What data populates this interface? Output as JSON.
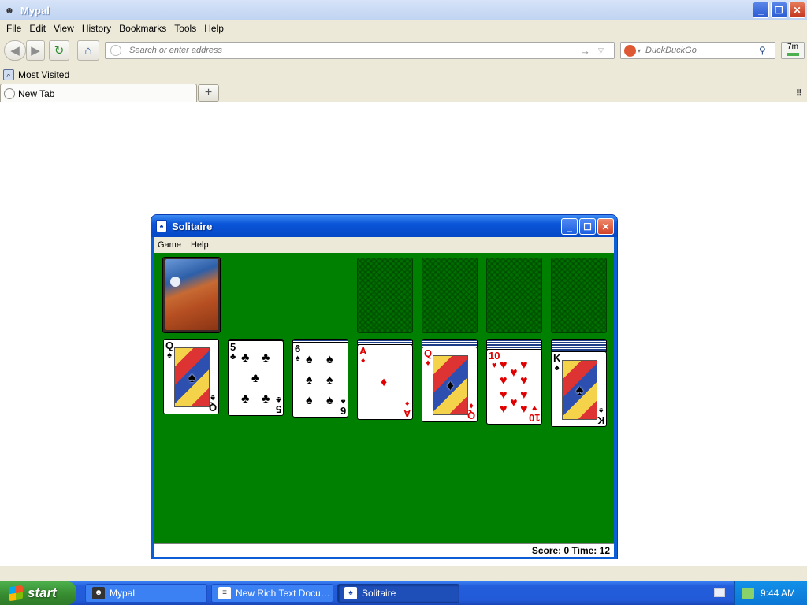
{
  "browser": {
    "title": "Mypal",
    "menu": [
      "File",
      "Edit",
      "View",
      "History",
      "Bookmarks",
      "Tools",
      "Help"
    ],
    "url_placeholder": "Search or enter address",
    "search_placeholder": "DuckDuckGo",
    "downloads_label": "7m",
    "bookmarks": [
      "Most Visited"
    ],
    "tab_title": "New Tab"
  },
  "solitaire": {
    "title": "Solitaire",
    "menu": [
      "Game",
      "Help"
    ],
    "status": "Score: 0 Time: 12",
    "tableau": [
      {
        "rank": "Q",
        "suit": "♠",
        "color": "#000000"
      },
      {
        "rank": "5",
        "suit": "♣",
        "color": "#000000"
      },
      {
        "rank": "6",
        "suit": "♠",
        "color": "#000000"
      },
      {
        "rank": "A",
        "suit": "♦",
        "color": "#e00000"
      },
      {
        "rank": "Q",
        "suit": "♦",
        "color": "#e00000"
      },
      {
        "rank": "10",
        "suit": "♥",
        "color": "#e00000"
      },
      {
        "rank": "K",
        "suit": "♠",
        "color": "#000000"
      }
    ]
  },
  "taskbar": {
    "start_label": "start",
    "tasks": [
      "Mypal",
      "New Rich Text Docum...",
      "Solitaire"
    ],
    "clock": "9:44 AM"
  },
  "icons": {
    "back": "arrow-left-icon",
    "forward": "arrow-right-icon",
    "reload": "reload-icon",
    "home": "home-icon",
    "search": "magnifier-icon"
  }
}
